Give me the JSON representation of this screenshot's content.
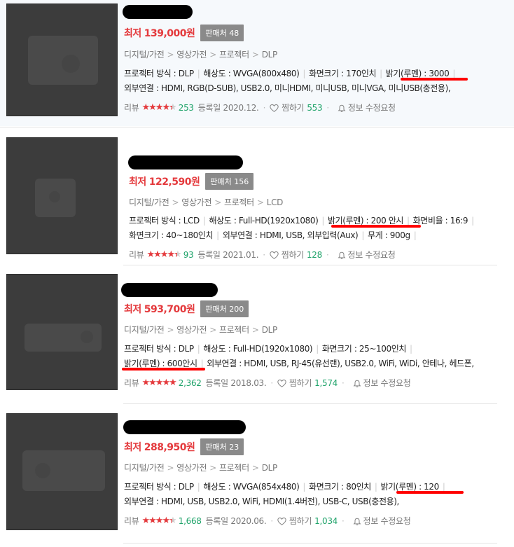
{
  "listings": [
    {
      "price_prefix": "최저",
      "price": "139,000원",
      "sellers": "판매처 48",
      "category": [
        "디지털/가전",
        "영상가전",
        "프로젝터",
        "DLP"
      ],
      "spec_line1": [
        "프로젝터 방식 : DLP",
        "해상도 : WVGA(800x480)",
        "화면크기 : 170인치",
        "밝기(루멘) : 3000"
      ],
      "spec_line2": [
        "외부연결 : HDMI, RGB(D-SUB), USB2.0, 미니HDMI, 미니USB, 미니VGA, 미니USB(충전용),"
      ],
      "review_label": "리뷰",
      "rating_stars": 4.5,
      "review_count": "253",
      "reg_date": "등록일 2020.12.",
      "zzim_label": "찜하기",
      "zzim_count": "553",
      "edit_label": "정보 수정요청"
    },
    {
      "price_prefix": "최저",
      "price": "122,590원",
      "sellers": "판매처 156",
      "category": [
        "디지털/가전",
        "영상가전",
        "프로젝터",
        "LCD"
      ],
      "spec_line1": [
        "프로젝터 방식 : LCD",
        "해상도 : Full-HD(1920x1080)",
        "밝기(루멘) : 200 안시",
        "화면비율 : 16:9"
      ],
      "spec_line2": [
        "화면크기 : 40~180인치",
        "외부연결 : HDMI, USB, 외부입력(Aux)",
        "무게 : 900g"
      ],
      "review_label": "리뷰",
      "rating_stars": 4.5,
      "review_count": "93",
      "reg_date": "등록일 2021.01.",
      "zzim_label": "찜하기",
      "zzim_count": "128",
      "edit_label": "정보 수정요청"
    },
    {
      "price_prefix": "최저",
      "price": "593,700원",
      "sellers": "판매처 200",
      "category": [
        "디지털/가전",
        "영상가전",
        "프로젝터",
        "DLP"
      ],
      "spec_line1": [
        "프로젝터 방식 : DLP",
        "해상도 : Full-HD(1920x1080)",
        "화면크기 : 25~100인치"
      ],
      "spec_line2": [
        "밝기(루멘) : 600안시",
        "외부연결 : HDMI, USB, RJ-45(유선랜), USB2.0, WiFi, WiDi, 안테나, 헤드폰,"
      ],
      "review_label": "리뷰",
      "rating_stars": 5,
      "review_count": "2,362",
      "reg_date": "등록일 2018.03.",
      "zzim_label": "찜하기",
      "zzim_count": "1,574",
      "edit_label": "정보 수정요청"
    },
    {
      "price_prefix": "최저",
      "price": "288,950원",
      "sellers": "판매처 23",
      "category": [
        "디지털/가전",
        "영상가전",
        "프로젝터",
        "DLP"
      ],
      "spec_line1": [
        "프로젝터 방식 : DLP",
        "해상도 : WVGA(854x480)",
        "화면크기 : 80인치",
        "밝기(루멘) : 120"
      ],
      "spec_line2": [
        "외부연결 : HDMI, USB, USB2.0, WiFi, HDMI(1.4버전), USB-C, USB(충전용),"
      ],
      "review_label": "리뷰",
      "rating_stars": 4.5,
      "review_count": "1,668",
      "reg_date": "등록일 2020.06.",
      "zzim_label": "찜하기",
      "zzim_count": "1,034",
      "edit_label": "정보 수정요청"
    }
  ]
}
